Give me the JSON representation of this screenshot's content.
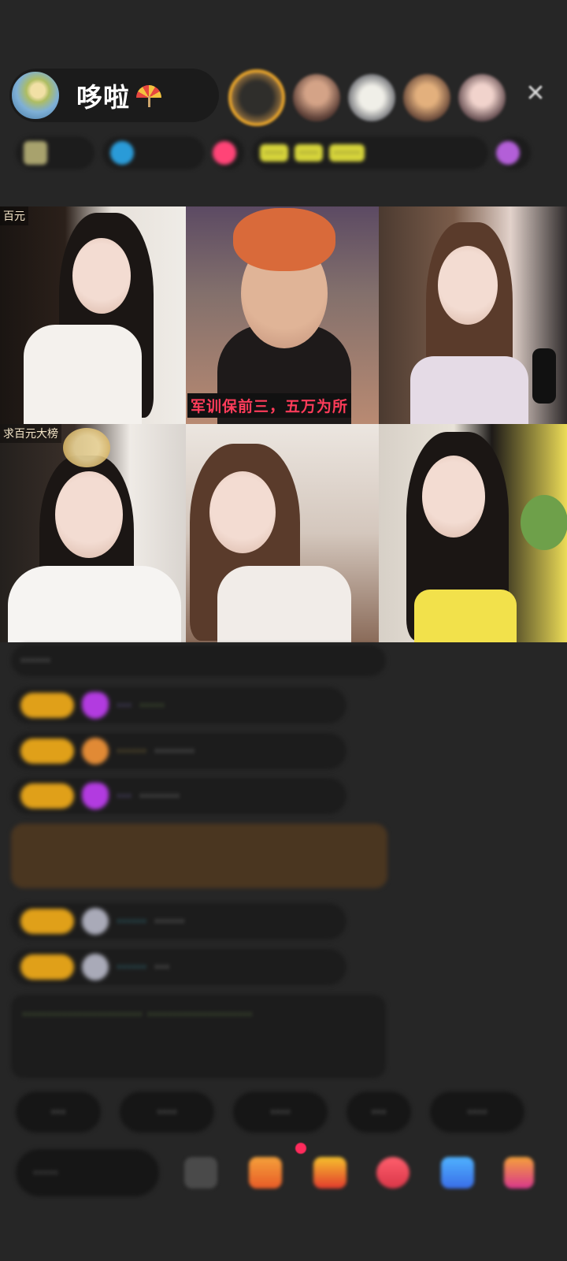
{
  "host": {
    "name": "哆啦",
    "emoji": "umbrella"
  },
  "viewers": [
    "viewer-1",
    "viewer-2",
    "viewer-3",
    "viewer-4",
    "viewer-5"
  ],
  "badges": [
    {
      "text": "···",
      "color": "#a8a26d"
    },
    {
      "text": "·····",
      "color": "#2a9bd8"
    },
    {
      "text": "",
      "color": "#ff4477"
    },
    {
      "text": "···· ····",
      "color": "#d5d33a"
    },
    {
      "text": "",
      "color": "#b35fd8"
    }
  ],
  "grid": {
    "tiles": [
      {
        "label": "百元",
        "subtitle": ""
      },
      {
        "label": "",
        "subtitle": "军训保前三，五万为所"
      },
      {
        "label": "",
        "subtitle": ""
      },
      {
        "label": "求百元大榜",
        "subtitle": ""
      },
      {
        "label": "",
        "subtitle": ""
      },
      {
        "label": "",
        "subtitle": ""
      }
    ]
  },
  "chat": {
    "messages": [
      {
        "name": "····",
        "text": "······"
      },
      {
        "name": "···",
        "text": "·····"
      },
      {
        "name": "······",
        "text": "········"
      },
      {
        "name": "···",
        "text": "········"
      },
      {
        "name": "······",
        "text": "······"
      },
      {
        "name": "······",
        "text": "···"
      }
    ],
    "system": "························ ·····················"
  },
  "quick_replies": [
    "···",
    "····",
    "····",
    "···",
    "····"
  ],
  "input": {
    "placeholder": "·····"
  }
}
